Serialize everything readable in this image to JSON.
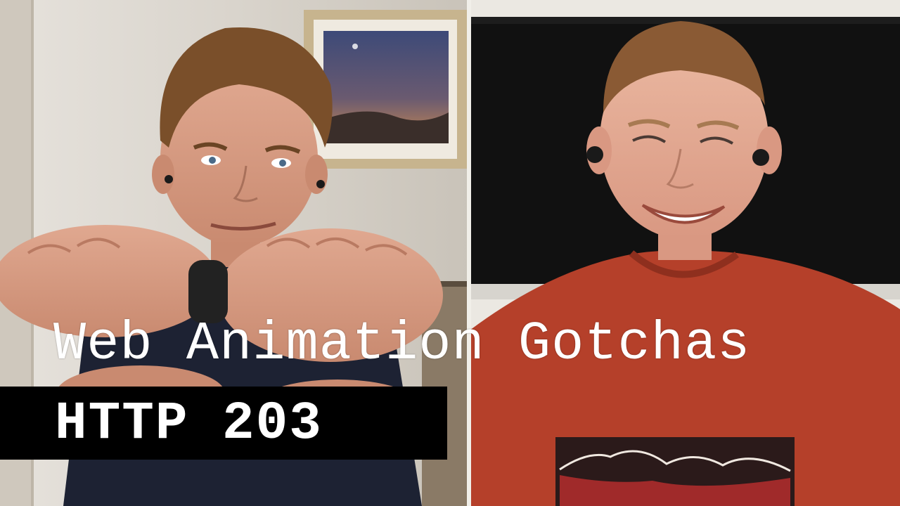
{
  "video_title": "Web Animation Gotchas",
  "show_name": "HTTP 203",
  "colors": {
    "overlay_text": "#ffffff",
    "label_background": "#000000",
    "left_wall": "#d8d3cb",
    "right_shirt": "#b5402a",
    "monitor": "#111111"
  }
}
